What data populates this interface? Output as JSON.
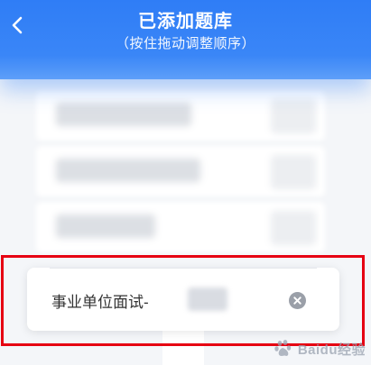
{
  "header": {
    "title": "已添加题库",
    "subtitle": "（按住拖动调整顺序）",
    "back_icon": "chevron-left-icon"
  },
  "list": {
    "dragged_item": {
      "label": "事业单位面试-",
      "remove_icon": "close-circle-icon"
    }
  },
  "watermark": {
    "brand_text": "Baidu经验"
  },
  "colors": {
    "header_blue": "#2f7df6",
    "highlight_red": "#e60012",
    "remove_icon_gray": "#9a9fa8",
    "text_dark": "#333333"
  }
}
